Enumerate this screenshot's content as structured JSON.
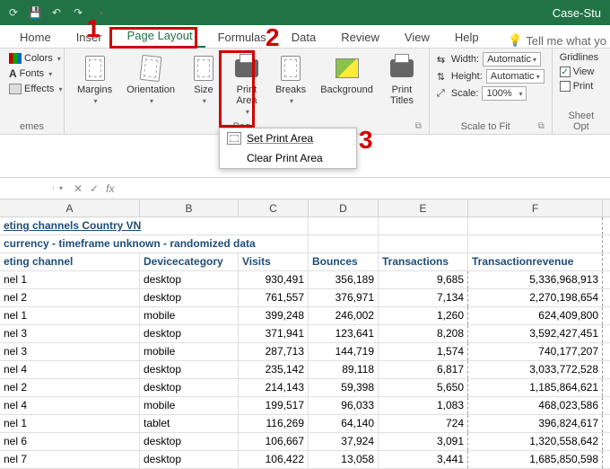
{
  "colors": {
    "accent": "#217346",
    "highlight": "#d10000"
  },
  "titlebar": {
    "doc_name": "Case-Stu"
  },
  "tabs": [
    "Home",
    "Inser",
    "Page Layout",
    "Formulas",
    "Data",
    "Review",
    "View",
    "Help"
  ],
  "active_tab_index": 2,
  "tellme": "Tell me what yo",
  "ribbon": {
    "themes": {
      "colors": "Colors",
      "fonts": "Fonts",
      "effects": "Effects",
      "group_label": "emes"
    },
    "page_setup": {
      "margins": "Margins",
      "orientation": "Orientation",
      "size": "Size",
      "print_area": "Print\nArea",
      "breaks": "Breaks",
      "background": "Background",
      "print_titles": "Print\nTitles",
      "group_label": "Pag"
    },
    "scale": {
      "width_label": "Width:",
      "width_value": "Automatic",
      "height_label": "Height:",
      "height_value": "Automatic",
      "scale_label": "Scale:",
      "scale_value": "100%",
      "group_label": "Scale to Fit"
    },
    "sheet_opts": {
      "gridlines": "Gridlines",
      "view": "View",
      "print": "Print",
      "group_label": "Sheet Opt"
    }
  },
  "print_area_menu": {
    "set": "Set Print Area",
    "clear": "Clear Print Area"
  },
  "annotations": {
    "n1": "1",
    "n2": "2",
    "n3": "3"
  },
  "formula_bar": {
    "name": "",
    "fx": "fx"
  },
  "columns": [
    "A",
    "B",
    "C",
    "D",
    "E",
    "F"
  ],
  "sheet_header": {
    "title": "eting channels Country VN",
    "subtitle": "currency - timeframe unknown - randomized data",
    "cols": [
      "eting channel",
      "Devicecategory",
      "Visits",
      "Bounces",
      "Transactions",
      "Transactionrevenue"
    ]
  },
  "rows": [
    {
      "ch": "nel 1",
      "dev": "desktop",
      "v": "930,491",
      "b": "356,189",
      "t": "9,685",
      "r": "5,336,968,913"
    },
    {
      "ch": "nel 2",
      "dev": "desktop",
      "v": "761,557",
      "b": "376,971",
      "t": "7,134",
      "r": "2,270,198,654"
    },
    {
      "ch": "nel 1",
      "dev": "mobile",
      "v": "399,248",
      "b": "246,002",
      "t": "1,260",
      "r": "624,409,800"
    },
    {
      "ch": "nel 3",
      "dev": "desktop",
      "v": "371,941",
      "b": "123,641",
      "t": "8,208",
      "r": "3,592,427,451"
    },
    {
      "ch": "nel 3",
      "dev": "mobile",
      "v": "287,713",
      "b": "144,719",
      "t": "1,574",
      "r": "740,177,207"
    },
    {
      "ch": "nel 4",
      "dev": "desktop",
      "v": "235,142",
      "b": "89,118",
      "t": "6,817",
      "r": "3,033,772,528"
    },
    {
      "ch": "nel 2",
      "dev": "desktop",
      "v": "214,143",
      "b": "59,398",
      "t": "5,650",
      "r": "1,185,864,621"
    },
    {
      "ch": "nel 4",
      "dev": "mobile",
      "v": "199,517",
      "b": "96,033",
      "t": "1,083",
      "r": "468,023,586"
    },
    {
      "ch": "nel 1",
      "dev": "tablet",
      "v": "116,269",
      "b": "64,140",
      "t": "724",
      "r": "396,824,617"
    },
    {
      "ch": "nel 6",
      "dev": "desktop",
      "v": "106,667",
      "b": "37,924",
      "t": "3,091",
      "r": "1,320,558,642"
    },
    {
      "ch": "nel 7",
      "dev": "desktop",
      "v": "106,422",
      "b": "13,058",
      "t": "3,441",
      "r": "1,685,850,598"
    }
  ]
}
